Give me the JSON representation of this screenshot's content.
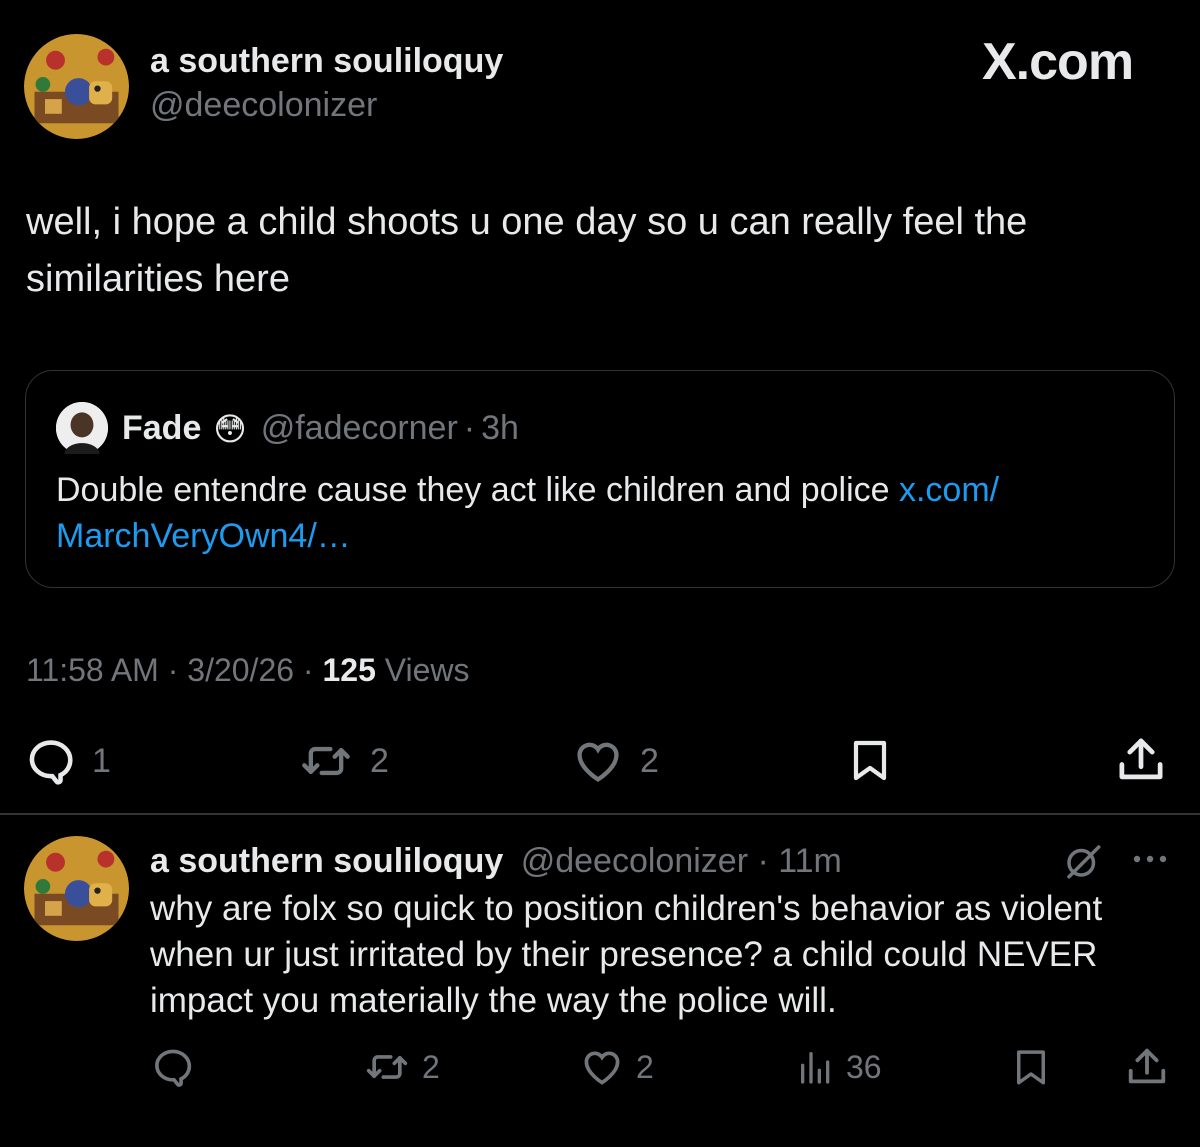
{
  "tweet": {
    "author_name": "a southern souliloquy",
    "author_handle": "@deecolonizer",
    "brand": "X.com",
    "text_line1": "well, i hope a child shoots u one day so u can really feel the",
    "text_line2": "similarities here",
    "quote": {
      "name": "Fade",
      "emoji": "😳",
      "handle": "@fadecorner",
      "time": "3h",
      "text": "Double entendre cause they act like children and police ",
      "link_part1": "x.com/",
      "link_part2": "MarchVeryOwn4/…"
    },
    "time": "11:58 AM",
    "date": "3/20/26",
    "views_count": "125",
    "views_label": "Views",
    "actions": {
      "reply_count": "1",
      "retweet_count": "2",
      "like_count": "2"
    }
  },
  "reply": {
    "author_name": "a southern souliloquy",
    "author_handle": "@deecolonizer",
    "time": "11m",
    "line1": "why are folx so quick to position children's behavior as violent",
    "line2": "when ur just irritated by their presence? a child could NEVER",
    "line3": "impact you materially the way the police will.",
    "actions": {
      "retweet_count": "2",
      "like_count": "2",
      "views_count": "36"
    }
  },
  "colors": {
    "background": "#000000",
    "text": "#e7e9ea",
    "muted": "#71767b",
    "link": "#1d9bf0",
    "border": "#2f3336"
  },
  "icons": [
    "reply-icon",
    "retweet-icon",
    "like-icon",
    "bookmark-icon",
    "share-icon",
    "views-icon",
    "grok-icon",
    "more-icon"
  ]
}
